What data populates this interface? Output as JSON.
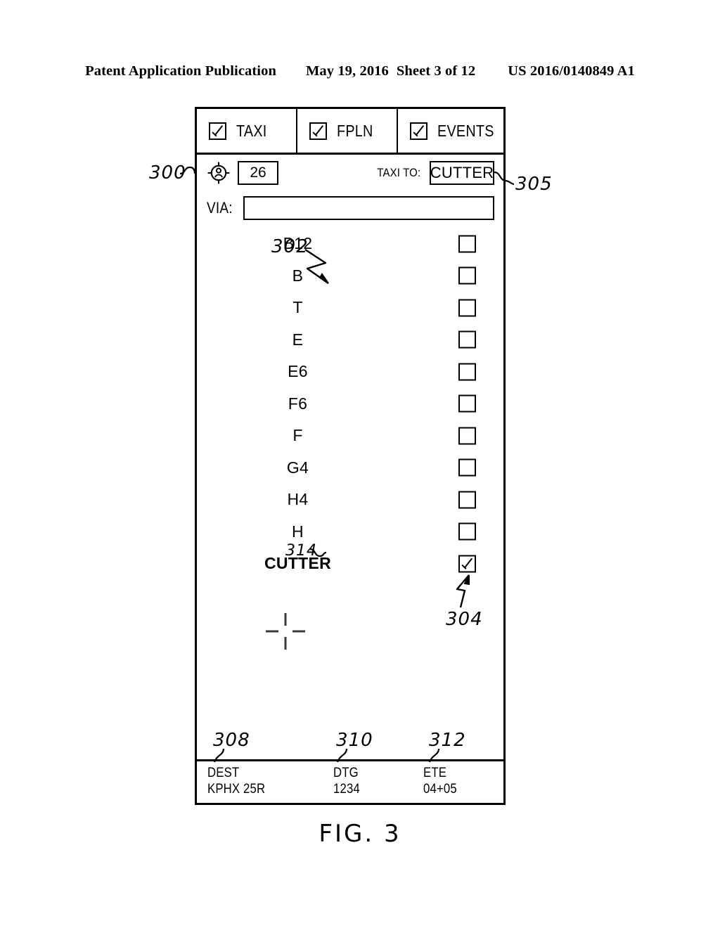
{
  "page_header": {
    "publication": "Patent Application Publication",
    "date": "May 19, 2016",
    "sheet": "Sheet 3 of 12",
    "publication_number": "US 2016/0140849 A1"
  },
  "figure": {
    "caption": "FIG. 3"
  },
  "panel": {
    "tabs": [
      {
        "label": "TAXI",
        "checked": true,
        "icon": "checkbox-checked-icon"
      },
      {
        "label": "FPLN",
        "checked": true,
        "icon": "checkbox-checked-icon"
      },
      {
        "label": "EVENTS",
        "checked": true,
        "icon": "checkbox-checked-icon"
      }
    ],
    "taxi_row": {
      "aircraft_icon": "aircraft-target-icon",
      "ident_value": "26",
      "taxi_to_label": "TAXI TO:",
      "destination_value": "CUTTER"
    },
    "via_row": {
      "label": "VIA:",
      "value": "",
      "placeholder": ""
    },
    "waypoints": [
      {
        "name": "B12",
        "checked": false
      },
      {
        "name": "B",
        "checked": false
      },
      {
        "name": "T",
        "checked": false
      },
      {
        "name": "E",
        "checked": false
      },
      {
        "name": "E6",
        "checked": false
      },
      {
        "name": "F6",
        "checked": false
      },
      {
        "name": "F",
        "checked": false
      },
      {
        "name": "G4",
        "checked": false
      },
      {
        "name": "H4",
        "checked": false
      },
      {
        "name": "H",
        "checked": false
      },
      {
        "name": "CUTTER",
        "checked": true
      }
    ],
    "map_symbol": "crosshair-icon",
    "status_bar": [
      {
        "key": "DEST",
        "value": "KPHX 25R"
      },
      {
        "key": "DTG",
        "value": "1234"
      },
      {
        "key": "ETE",
        "value": "04+05"
      }
    ]
  },
  "reference_numerals": {
    "panel": "300",
    "waypoint_list": "302",
    "selected_checkbox": "304",
    "destination_button": "305",
    "dest_field": "308",
    "dtg_field": "310",
    "ete_field": "312",
    "selected_waypoint": "314"
  },
  "colors": {
    "ink": "#000000",
    "paper": "#ffffff"
  }
}
